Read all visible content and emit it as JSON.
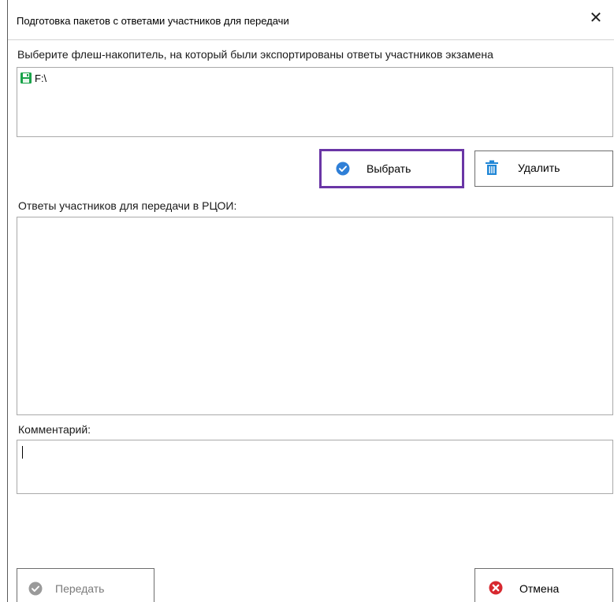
{
  "dialog": {
    "title": "Подготовка пакетов с ответами участников для передачи",
    "close_symbol": "✕"
  },
  "drive_section": {
    "label": "Выберите флеш-накопитель, на который были экспортированы ответы участников экзамена",
    "drives": [
      {
        "name": "F:\\",
        "icon": "floppy-disk-icon",
        "icon_color": "#1aa34a"
      }
    ]
  },
  "actions": {
    "select_label": "Выбрать",
    "delete_label": "Удалить"
  },
  "answers_section": {
    "label": "Ответы участников для передачи в РЦОИ:",
    "items": []
  },
  "comment_section": {
    "label": "Комментарий:",
    "value": ""
  },
  "footer": {
    "transfer_label": "Передать",
    "cancel_label": "Отмена"
  },
  "colors": {
    "accent_check": "#2f7fd7",
    "delete_icon": "#1f86d6",
    "cancel_icon": "#d7282f",
    "focus_border": "#6a36a6",
    "disabled_icon": "#9a9a9a"
  }
}
